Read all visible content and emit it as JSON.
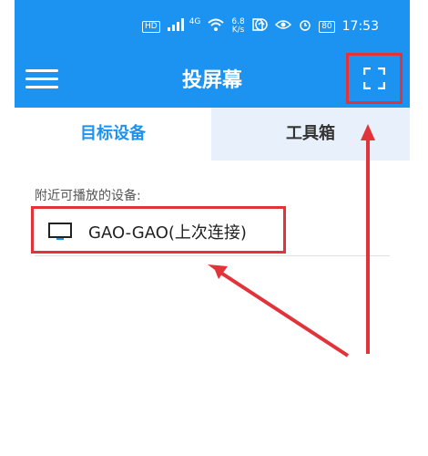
{
  "status_bar": {
    "hd_label": "HD",
    "signal_label": "4G",
    "speed_value": "6.8",
    "speed_unit": "K/s",
    "battery_label": "80",
    "time": "17:53"
  },
  "app_bar": {
    "title": "投屏幕",
    "menu_icon": "hamburger-menu-icon",
    "scan_icon": "scan-frame-icon"
  },
  "tabs": [
    {
      "label": "目标设备",
      "active": true
    },
    {
      "label": "工具箱",
      "active": false
    }
  ],
  "content": {
    "section_label": "附近可播放的设备:",
    "devices": [
      {
        "name": "GAO-GAO(上次连接)",
        "icon": "monitor-icon"
      }
    ]
  },
  "colors": {
    "primary": "#1c93f0",
    "annotation_red": "#e2333a",
    "tab_inactive_bg": "#e8f1fb"
  }
}
